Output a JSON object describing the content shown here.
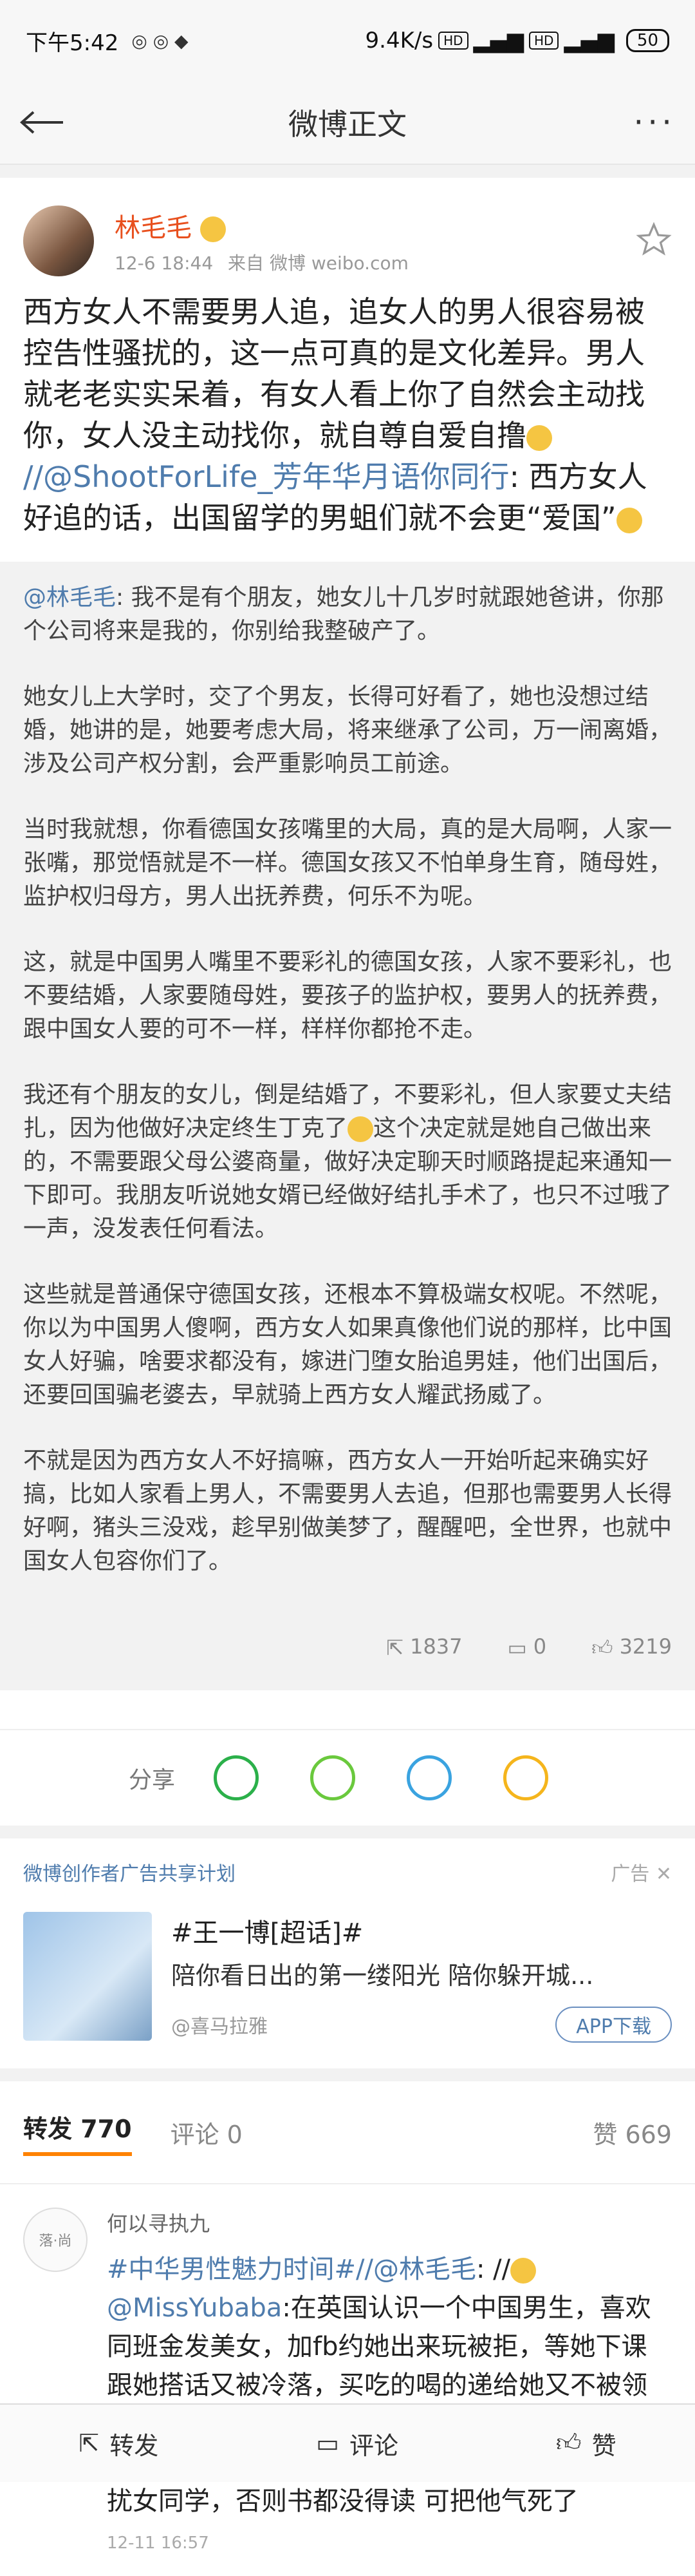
{
  "status_bar": {
    "time": "下午5:42",
    "network_speed": "9.4K/s",
    "battery": "50"
  },
  "nav": {
    "title": "微博正文"
  },
  "post": {
    "author": "林毛毛",
    "timestamp": "12-6 18:44",
    "source": "来自 微博 weibo.com",
    "text_part1": "西方女人不需要男人追，追女人的男人很容易被控告性骚扰的，这一点可真的是文化差异。男人就老老实实呆着，有女人看上你了自然会主动找你，女人没主动找你，就自尊自爱自撸",
    "text_link": "//@ShootForLife_芳年华月语你同行",
    "text_part2": ": 西方女人好追的话，出国留学的男蛆们就不会更“爱国”",
    "repost_mention": "@林毛毛",
    "repost_p1": ": 我不是有个朋友，她女儿十几岁时就跟她爸讲，你那个公司将来是我的，你别给我整破产了。",
    "repost_p2": "她女儿上大学时，交了个男友，长得可好看了，她也没想过结婚，她讲的是，她要考虑大局，将来继承了公司，万一闹离婚，涉及公司产权分割，会严重影响员工前途。",
    "repost_p3": "当时我就想，你看德国女孩嘴里的大局，真的是大局啊，人家一张嘴，那觉悟就是不一样。德国女孩又不怕单身生育，随母姓，监护权归母方，男人出抚养费，何乐不为呢。",
    "repost_p4": "这，就是中国男人嘴里不要彩礼的德国女孩，人家不要彩礼，也不要结婚，人家要随母姓，要孩子的监护权，要男人的抚养费，跟中国女人要的可不一样，样样你都抢不走。",
    "repost_p5a": "我还有个朋友的女儿，倒是结婚了，不要彩礼，但人家要丈夫结扎，因为他做好决定终生丁克了",
    "repost_p5b": "这个决定就是她自己做出来的，不需要跟父母公婆商量，做好决定聊天时顺路提起来通知一下即可。我朋友听说她女婿已经做好结扎手术了，也只不过哦了一声，没发表任何看法。",
    "repost_p6": "这些就是普通保守德国女孩，还根本不算极端女权呢。不然呢，你以为中国男人傻啊，西方女人如果真像他们说的那样，比中国女人好骗，啥要求都没有，嫁进门堕女胎追男娃，他们出国后，还要回国骗老婆去，早就骑上西方女人耀武扬威了。",
    "repost_p7": "不就是因为西方女人不好搞嘛，西方女人一开始听起来确实好搞，比如人家看上男人，不需要男人去追，但那也需要男人长得好啊，猪头三没戏，趁早别做美梦了，醒醒吧，全世界，也就中国女人包容你们了。",
    "stats": {
      "reposts": "1837",
      "comments": "0",
      "likes": "3219"
    }
  },
  "share": {
    "label": "分享",
    "icons": [
      "wechat-icon",
      "moments-icon",
      "qq-icon",
      "qzone-icon"
    ]
  },
  "ad": {
    "program": "微博创作者广告共享计划",
    "tag": "广告",
    "title": "#王一博[超话]#",
    "subtitle": "陪你看日出的第一缕阳光 陪你躲开城...",
    "source": "@喜马拉雅",
    "button": "APP下载"
  },
  "tabs": {
    "repost_label": "转发 770",
    "comment_label": "评论 0",
    "like_label": "赞 669"
  },
  "comment": {
    "user": "何以寻执九",
    "avatar_text": "落·尚",
    "text_tag": "#中华男性魅力时间#",
    "text_mention1": "//@林毛毛",
    "text_mid": ": //",
    "text_mention2": "@MissYubaba",
    "text_body": ":在英国认识一个中国男生，喜欢同班金发美女，加fb约她出来玩被拒，等她下课跟她搭话又被冷落，买吃的喝的递给她又不被领情，正觉得自己心意得不到回应委屈要死的时候，女生把他告了。最后他被学生处警告停止骚扰女同学，否则书都没得读 可把他气死了",
    "date": "12-11 16:57"
  },
  "bottom_bar": {
    "repost": "转发",
    "comment": "评论",
    "like": "赞"
  },
  "colors": {
    "accent": "#ff8200",
    "link": "#4f7cad",
    "author_name": "#e8501e"
  }
}
